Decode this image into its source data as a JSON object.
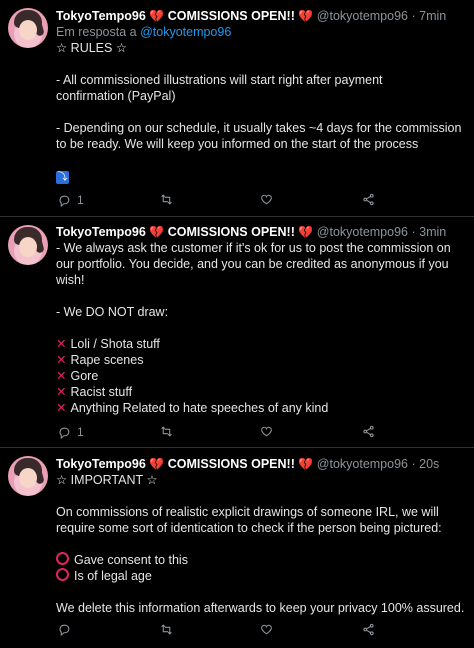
{
  "tweets": [
    {
      "display_name": "TokyoTempo96",
      "heart_icon": "💔",
      "title_text": "COMISSIONS OPEN!!",
      "handle": "@tokyotempo96",
      "dot": "·",
      "time": "7min",
      "reply_prefix": "Em resposta a",
      "reply_to": "@tokyotempo96",
      "lines": [
        "☆ RULES ☆",
        "",
        "- All commissioned illustrations will start right after payment",
        "confirmation (PayPal)",
        "",
        "- Depending on our schedule, it usually takes ~4 days for the commission",
        "to be ready. We will keep you informed on the start of the process",
        ""
      ],
      "thread_badge": "⤵",
      "reply_count": "1",
      "retweet_count": "",
      "like_count": ""
    },
    {
      "display_name": "TokyoTempo96",
      "heart_icon": "💔",
      "title_text": "COMISSIONS OPEN!!",
      "handle": "@tokyotempo96",
      "dot": "·",
      "time": "3min",
      "lines": [
        "- We always ask the customer if it's ok for us to post the commission on",
        "our portfolio. You decide, and you can be credited as anonymous if you",
        "wish!",
        "",
        "- We DO NOT draw:",
        ""
      ],
      "list_items": [
        "Loli / Shota stuff",
        "Rape scenes",
        "Gore",
        "Racist stuff",
        "Anything Related to hate speeches of any kind"
      ],
      "reply_count": "1",
      "retweet_count": "",
      "like_count": ""
    },
    {
      "display_name": "TokyoTempo96",
      "heart_icon": "💔",
      "title_text": "COMISSIONS OPEN!!",
      "handle": "@tokyotempo96",
      "dot": "·",
      "time": "20s",
      "lines": [
        "☆ IMPORTANT ☆",
        "",
        "On commissions of realistic explicit drawings of someone IRL, we will",
        "require some sort of identication to check if the person being pictured:",
        ""
      ],
      "list_items": [
        "Gave consent to this",
        "Is of legal age"
      ],
      "lines_after": [
        "",
        "We delete this information afterwards to keep your privacy 100% assured."
      ],
      "reply_count": "",
      "retweet_count": "",
      "like_count": ""
    }
  ],
  "colors": {
    "accent": "#1d9bf0",
    "heart": "#ff4f8b",
    "mark": "#e0245e"
  }
}
